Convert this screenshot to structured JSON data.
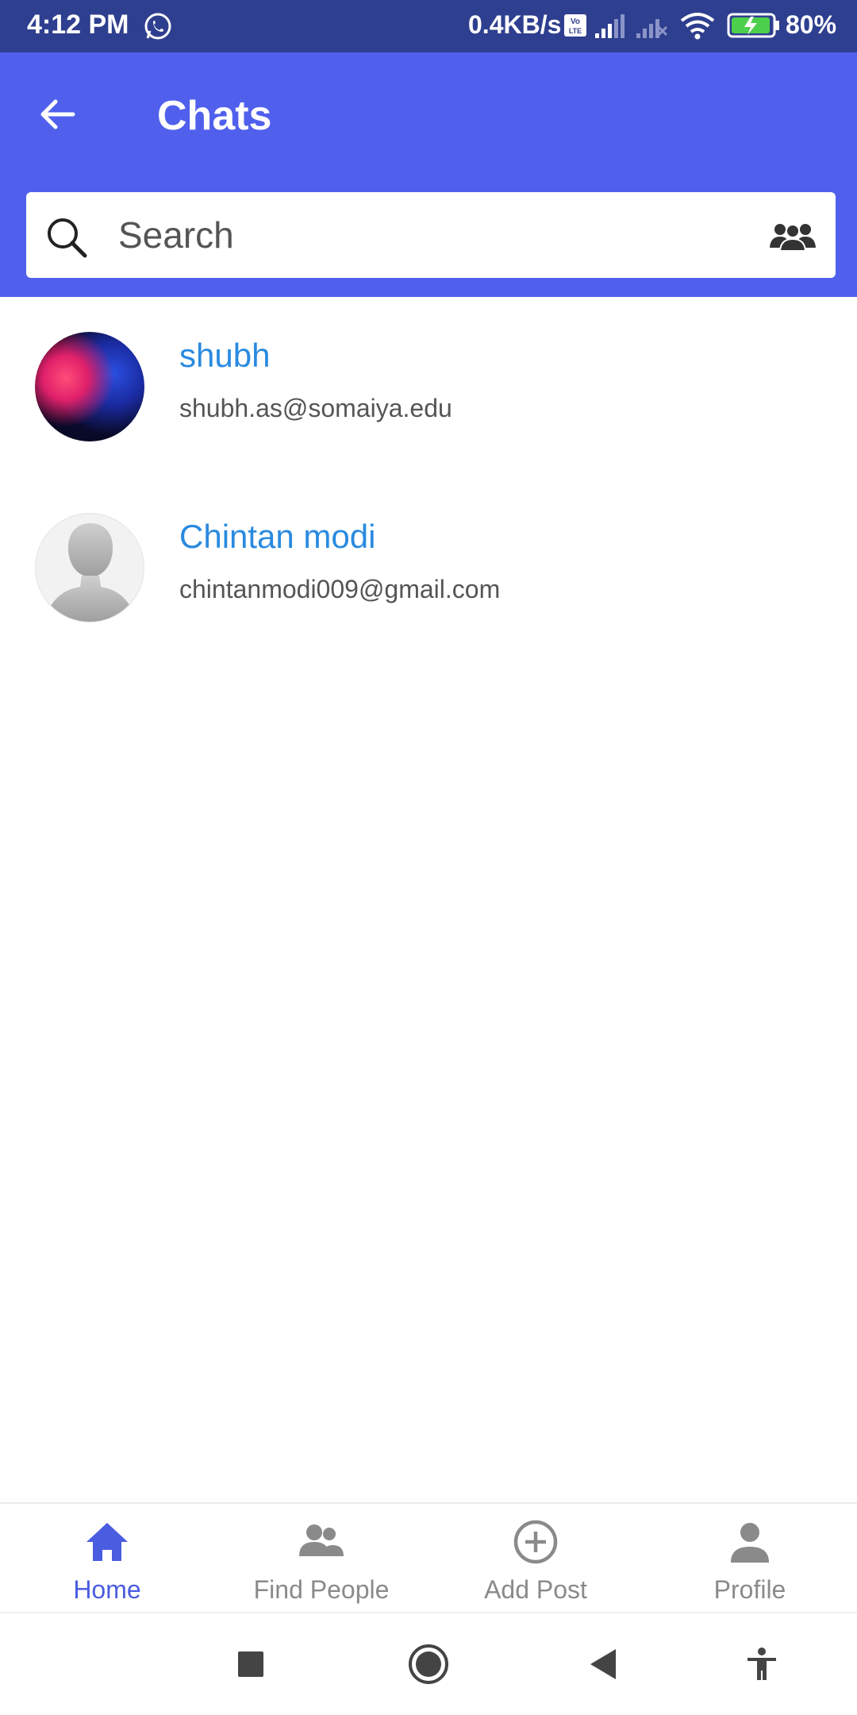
{
  "status_bar": {
    "time": "4:12 PM",
    "network_speed": "0.4KB/s",
    "battery": "80%"
  },
  "app_bar": {
    "title": "Chats"
  },
  "search": {
    "placeholder": "Search"
  },
  "chats": [
    {
      "name": "shubh",
      "email": "shubh.as@somaiya.edu"
    },
    {
      "name": "Chintan modi",
      "email": "chintanmodi009@gmail.com"
    }
  ],
  "bottom_nav": {
    "items": [
      {
        "label": "Home",
        "icon": "home-icon",
        "active": true
      },
      {
        "label": "Find People",
        "icon": "people-icon",
        "active": false
      },
      {
        "label": "Add Post",
        "icon": "add-circle-icon",
        "active": false
      },
      {
        "label": "Profile",
        "icon": "person-icon",
        "active": false
      }
    ]
  },
  "colors": {
    "status_bar": "#2f3f8f",
    "app_bar": "#5060ec",
    "chat_name": "#2a8ae0",
    "nav_active": "#4a5de0",
    "nav_inactive": "#8a8a8a"
  }
}
